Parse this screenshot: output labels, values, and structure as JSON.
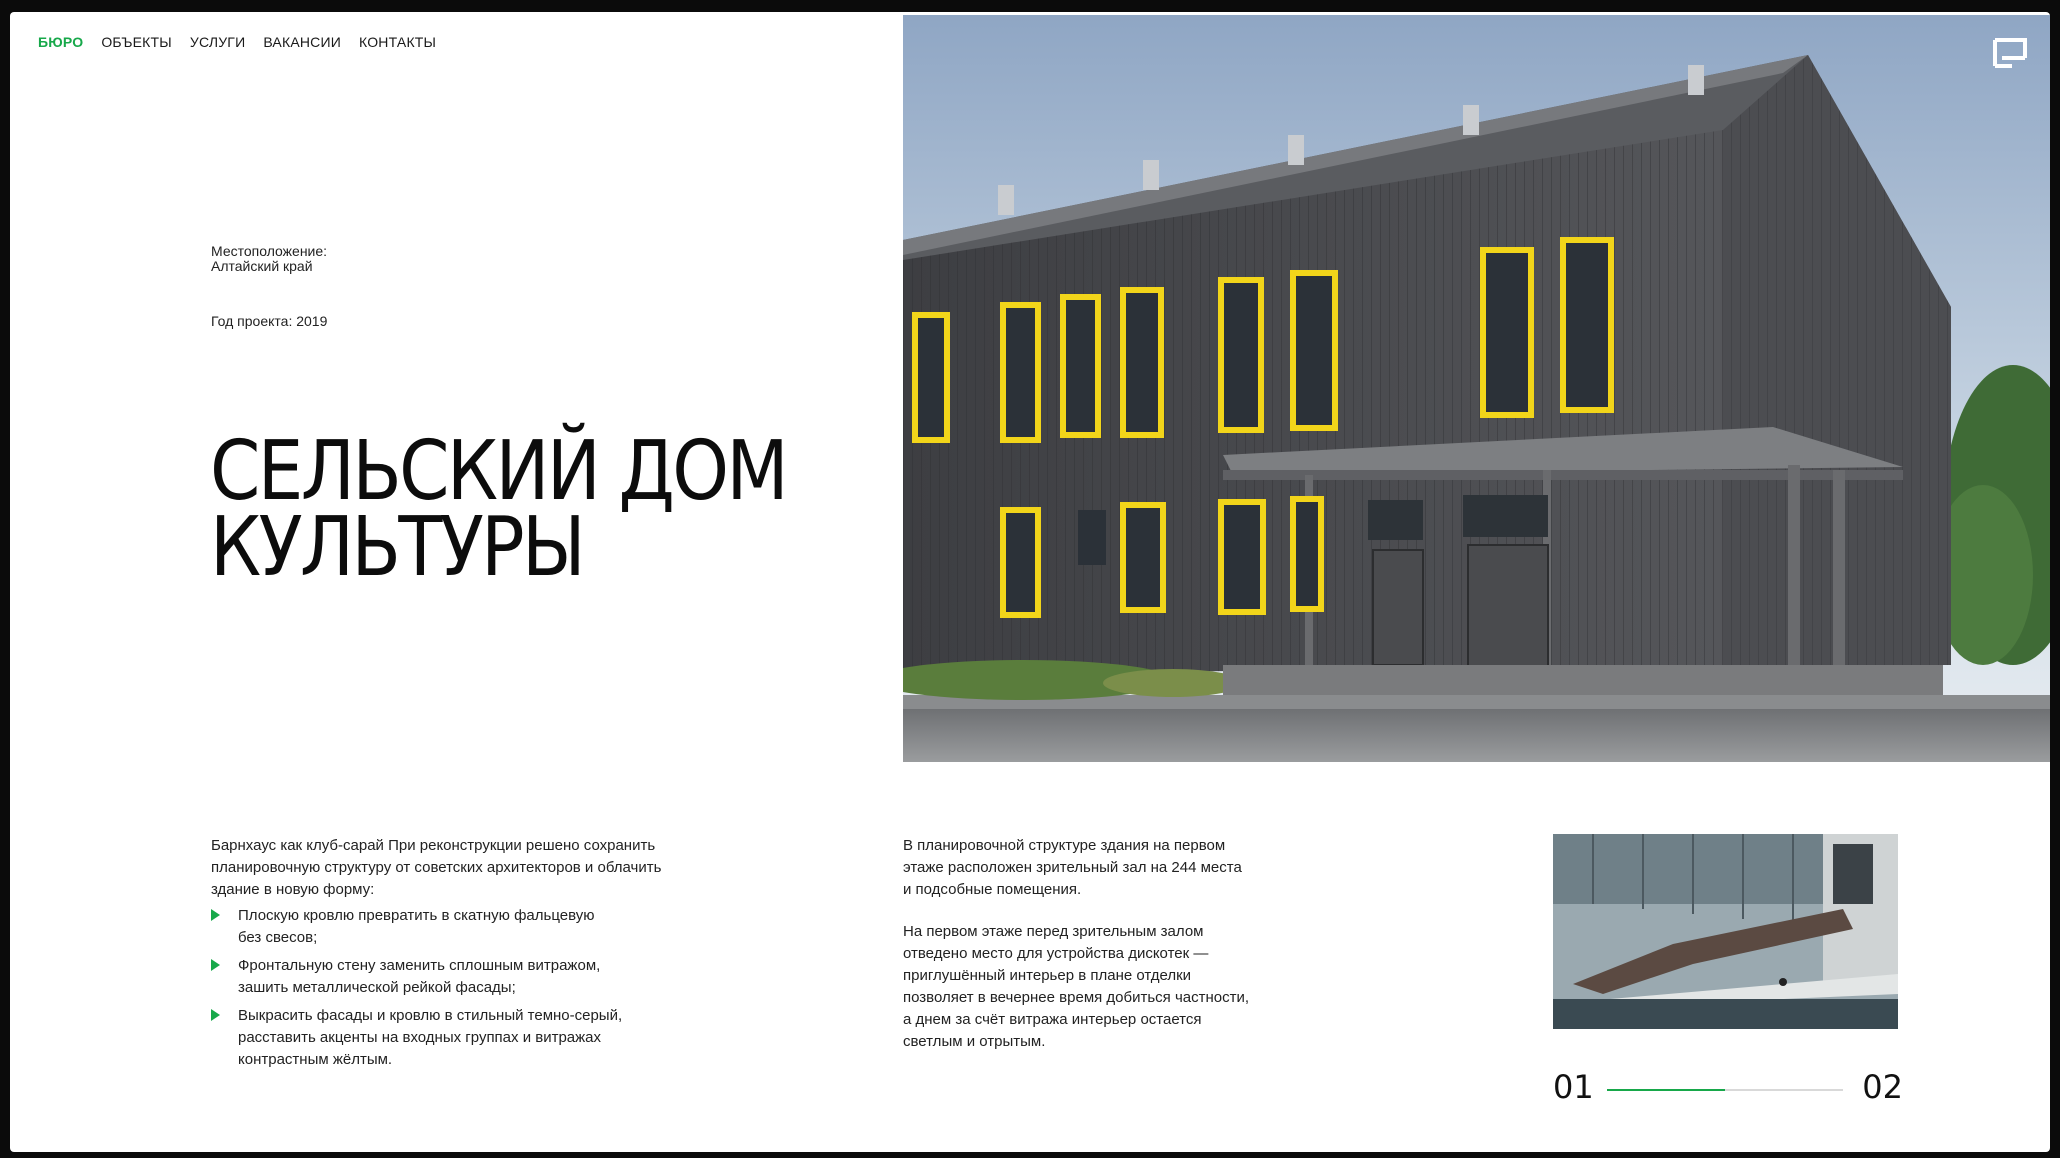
{
  "nav": {
    "items": [
      {
        "label": "БЮРО",
        "active": true
      },
      {
        "label": "ОБЪЕКТЫ",
        "active": false
      },
      {
        "label": "УСЛУГИ",
        "active": false
      },
      {
        "label": "ВАКАНСИИ",
        "active": false
      },
      {
        "label": "КОНТАКТЫ",
        "active": false
      }
    ]
  },
  "project": {
    "location_label": "Местоположение:",
    "location_value": "Алтайский край",
    "year_text": "Год проекта: 2019",
    "title_line1": "СЕЛЬСКИЙ ДОМ",
    "title_line2": "КУЛЬТУРЫ"
  },
  "description": {
    "intro_line1": "Барнхаус как клуб-сарай При реконструкции решено сохранить",
    "intro_line2": "планировочную структуру от советских архитекторов и облачить",
    "intro_line3": "здание в новую форму:",
    "bullets": [
      {
        "line1": "Плоскую кровлю превратить в скатную фальцевую",
        "line2": "без свесов;"
      },
      {
        "line1": "Фронтальную стену заменить сплошным витражом,",
        "line2": "зашить металлической рейкой фасады;"
      },
      {
        "line1": "Выкрасить фасады и кровлю в стильный темно-серый,",
        "line2": "расставить акценты на входных группах и витражах",
        "line3": "контрастным жёлтым."
      }
    ],
    "col2_p1_line1": "В планировочной структуре здания на первом",
    "col2_p1_line2": "этаже расположен зрительный зал на 244 места",
    "col2_p1_line3": "и подсобные помещения.",
    "col2_p2_line1": "На первом этаже перед зрительным залом",
    "col2_p2_line2": "отведено место для устройства дискотек —",
    "col2_p2_line3": "приглушённый интерьер в плане отделки",
    "col2_p2_line4": "позволяет в вечернее время добиться частности,",
    "col2_p2_line5": "а днем за счёт витража интерьер остается",
    "col2_p2_line6": "светлым и отрытым."
  },
  "slider": {
    "current": "01",
    "total": "02",
    "progress": 0.5
  },
  "colors": {
    "accent": "#17a84a",
    "window_frame": "#f2d51a",
    "facade": "#4a4b4e"
  },
  "icons": {
    "fullscreen": "fullscreen-icon",
    "bullet": "triangle-bullet-icon"
  }
}
